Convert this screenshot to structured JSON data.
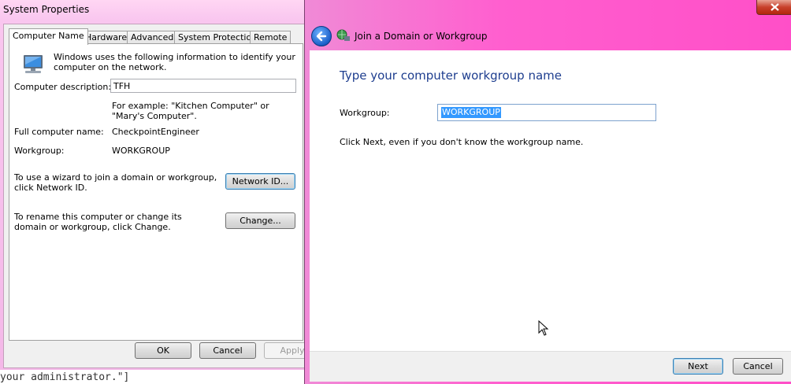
{
  "sysprops": {
    "title": "System Properties",
    "tabs": [
      "Computer Name",
      "Hardware",
      "Advanced",
      "System Protection",
      "Remote"
    ],
    "intro": "Windows uses the following information to identify your computer on the network.",
    "description_label": "Computer description:",
    "description_value": "TFH",
    "example_text": "For example: \"Kitchen Computer\" or \"Mary's Computer\".",
    "full_name_label": "Full computer name:",
    "full_name_value": "CheckpointEngineer",
    "workgroup_label": "Workgroup:",
    "workgroup_value": "WORKGROUP",
    "wizard_text": "To use a wizard to join a domain or workgroup, click Network ID.",
    "network_id_button": "Network ID...",
    "rename_text": "To rename this computer or change its domain or workgroup, click Change.",
    "change_button": "Change...",
    "ok_button": "OK",
    "cancel_button": "Cancel",
    "apply_button": "Apply"
  },
  "wizard": {
    "title": "Join a Domain or Workgroup",
    "heading": "Type your computer workgroup name",
    "workgroup_label": "Workgroup:",
    "workgroup_input_value": "WORKGROUP",
    "hint": "Click Next, even if you don't know the workgroup name.",
    "next_button": "Next",
    "cancel_button": "Cancel"
  },
  "background_text": "your administrator.\"]",
  "colors": {
    "title_pink": "#ff4fc8",
    "heading_blue": "#1e3e8f",
    "selection_blue": "#3399ff"
  }
}
